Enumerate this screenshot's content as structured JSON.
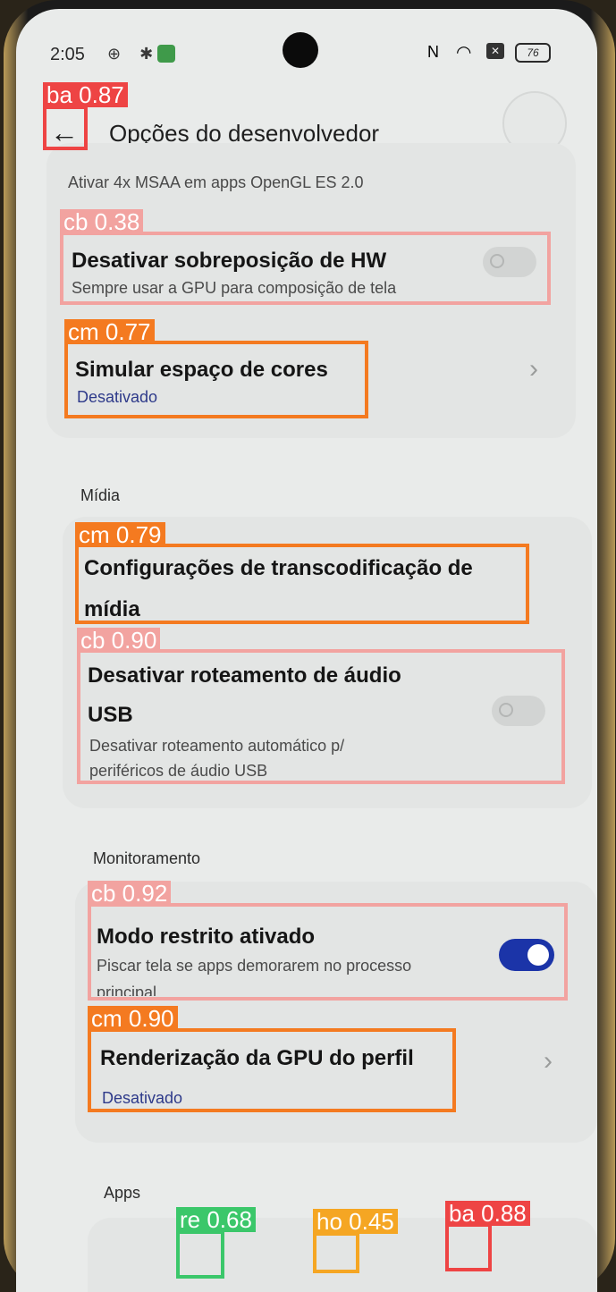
{
  "status_bar": {
    "time": "2:05",
    "left_icons": "⊕ ✱",
    "battery": "76",
    "nfc": "N",
    "wifi": "◠"
  },
  "header": {
    "back_glyph": "←",
    "title": "Opções do desenvolvedor"
  },
  "list": {
    "msaa_sub": "Ativar 4x MSAA em apps OpenGL ES 2.0",
    "hw_overlay": {
      "title": "Desativar sobreposição de HW",
      "subtitle": "Sempre usar a GPU para composição de tela",
      "enabled": false
    },
    "color_space": {
      "title": "Simular espaço de cores",
      "value": "Desativado"
    },
    "section_media": "Mídia",
    "transcoding": {
      "title_line1": "Configurações de transcodificação de",
      "title_line2": "mídia"
    },
    "usb_audio": {
      "title_line1": "Desativar roteamento de áudio",
      "title_line2": "USB",
      "sub_line1": "Desativar roteamento automático p/",
      "sub_line2": "periféricos de áudio USB",
      "enabled": false
    },
    "section_monitoring": "Monitoramento",
    "strict_mode": {
      "title": "Modo restrito ativado",
      "sub_line1": "Piscar tela se apps demorarem no processo",
      "sub_line2": "principal",
      "enabled": true
    },
    "gpu_profile": {
      "title": "Renderização da GPU do perfil",
      "value": "Desativado"
    },
    "section_apps": "Apps"
  },
  "detections": [
    {
      "label": "ba 0.87"
    },
    {
      "label": "cb 0.38"
    },
    {
      "label": "cm 0.77"
    },
    {
      "label": "cm 0.79"
    },
    {
      "label": "cb 0.90"
    },
    {
      "label": "cb 0.92"
    },
    {
      "label": "cm 0.90"
    },
    {
      "label": "re 0.68"
    },
    {
      "label": "ho 0.45"
    },
    {
      "label": "ba 0.88"
    }
  ],
  "colors": {
    "accent_toggle_on": "#1b34a8",
    "value_text": "#2e3a8a",
    "background": "#e9ebea"
  }
}
